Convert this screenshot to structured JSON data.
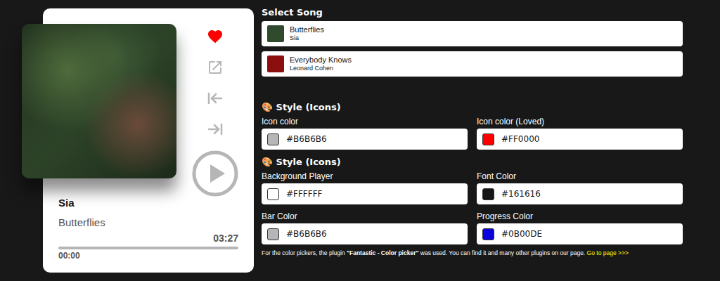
{
  "player": {
    "loved": true,
    "artist": "Sia",
    "title": "Butterflies",
    "duration": "03:27",
    "elapsed": "00:00",
    "level": 0
  },
  "song_list": {
    "title": "Select Song",
    "songs": [
      {
        "title": "Butterflies",
        "artist": "Sia",
        "color": "#2f4a2c"
      },
      {
        "title": "Everybody Knows",
        "artist": "Leonard Cohen",
        "color": "#8c0f0f"
      }
    ]
  },
  "style_sections": [
    {
      "title": "🎨 Style (Icons)",
      "fields": [
        {
          "label": "Icon color",
          "value": "#B6B6B6"
        },
        {
          "label": "Icon color (Loved)",
          "value": "#FF0000"
        }
      ]
    },
    {
      "title": "🎨 Style (Icons)",
      "fields": [
        {
          "label": "Background Player",
          "value": "#FFFFFF"
        },
        {
          "label": "Font Color",
          "value": "#161616"
        },
        {
          "label": "Bar Color",
          "value": "#B6B6B6"
        },
        {
          "label": "Progress Color",
          "value": "#0B00DE"
        }
      ]
    }
  ],
  "footnote": {
    "prefix": "For the color pickers, the plugin ",
    "plugin": "\"Fantastic - Color picker\"",
    "suffix": " was used. You can find it and many other plugins on our page. ",
    "link": "Go to page >>>"
  }
}
